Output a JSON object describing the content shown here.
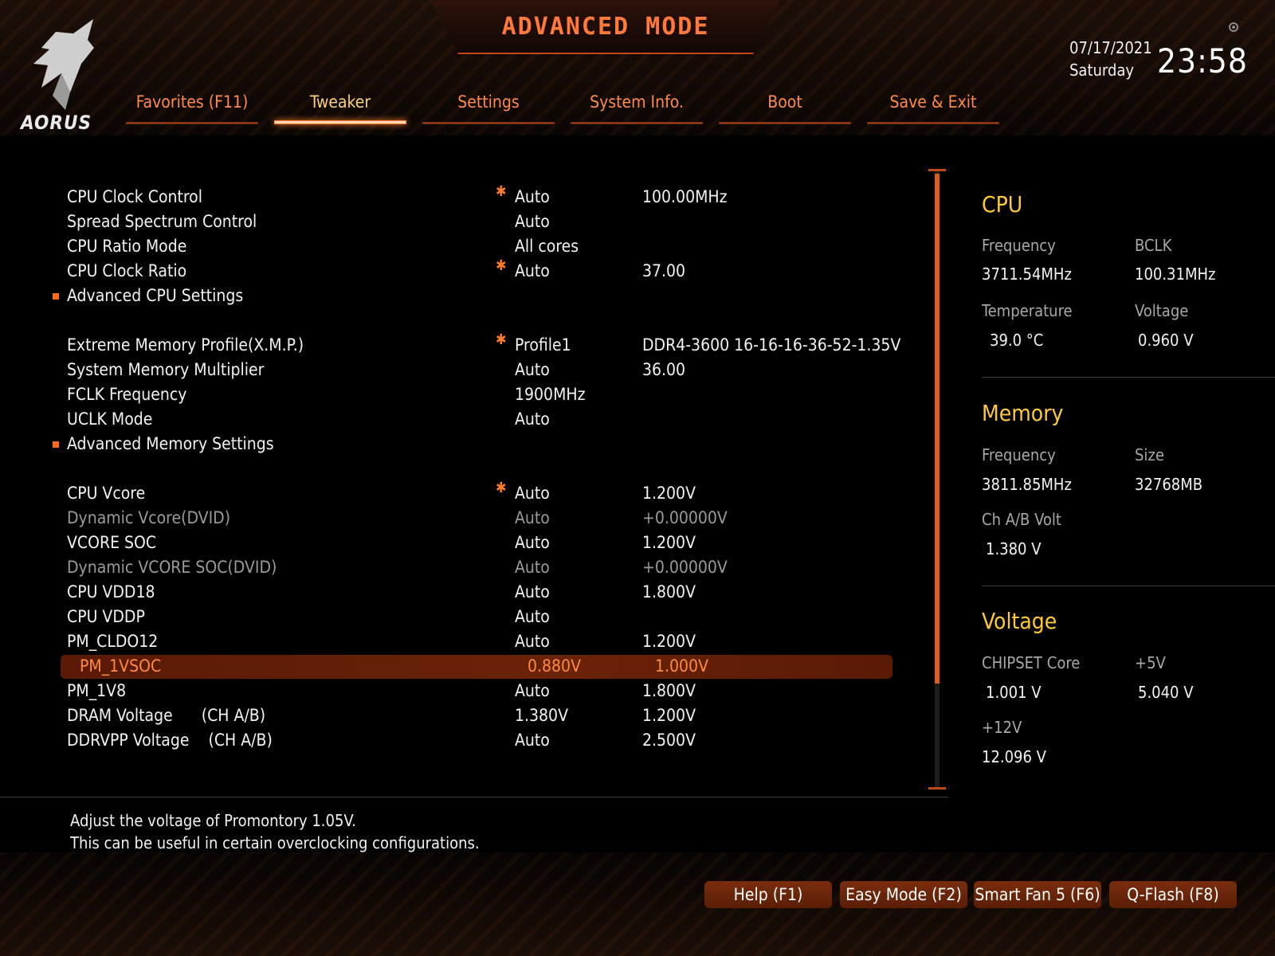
{
  "header": {
    "title": "ADVANCED MODE",
    "logo_text": "AORUS",
    "date": "07/17/2021",
    "day": "Saturday",
    "time": "23:58"
  },
  "tabs": [
    {
      "label": "Favorites (F11)"
    },
    {
      "label": "Tweaker",
      "active": true
    },
    {
      "label": "Settings"
    },
    {
      "label": "System Info."
    },
    {
      "label": "Boot"
    },
    {
      "label": "Save & Exit"
    }
  ],
  "settings": [
    {
      "name": "CPU Clock Control",
      "star": "✱",
      "v1": "Auto",
      "v2": "100.00MHz"
    },
    {
      "name": "Spread Spectrum Control",
      "star": "",
      "v1": "Auto",
      "v2": ""
    },
    {
      "name": "CPU Ratio Mode",
      "star": "",
      "v1": "All cores",
      "v2": ""
    },
    {
      "name": "CPU Clock Ratio",
      "star": "✱",
      "v1": "Auto",
      "v2": "37.00"
    },
    {
      "name": "Advanced CPU Settings",
      "star": "",
      "v1": "",
      "v2": "",
      "submenu": true
    },
    {
      "name": "Extreme Memory Profile(X.M.P.)",
      "star": "✱",
      "v1": "Profile1",
      "v2": "DDR4-3600 16-16-16-36-52-1.35V"
    },
    {
      "name": "System Memory Multiplier",
      "star": "",
      "v1": "Auto",
      "v2": "36.00"
    },
    {
      "name": "FCLK Frequency",
      "star": "",
      "v1": "1900MHz",
      "v2": ""
    },
    {
      "name": "UCLK Mode",
      "star": "",
      "v1": "Auto",
      "v2": ""
    },
    {
      "name": "Advanced Memory Settings",
      "star": "",
      "v1": "",
      "v2": "",
      "submenu": true
    },
    {
      "name": "CPU Vcore",
      "star": "✱",
      "v1": "Auto",
      "v2": "1.200V"
    },
    {
      "name": "Dynamic Vcore(DVID)",
      "star": "",
      "v1": "Auto",
      "v2": "+0.00000V",
      "dim": true
    },
    {
      "name": "VCORE SOC",
      "star": "",
      "v1": "Auto",
      "v2": "1.200V"
    },
    {
      "name": "Dynamic VCORE SOC(DVID)",
      "star": "",
      "v1": "Auto",
      "v2": "+0.00000V",
      "dim": true
    },
    {
      "name": "CPU VDD18",
      "star": "",
      "v1": "Auto",
      "v2": "1.800V"
    },
    {
      "name": "CPU VDDP",
      "star": "",
      "v1": "Auto",
      "v2": ""
    },
    {
      "name": "PM_CLDO12",
      "star": "",
      "v1": "Auto",
      "v2": "1.200V"
    },
    {
      "name": "PM_1VSOC",
      "star": "",
      "v1": "0.880V",
      "v2": "1.000V",
      "selected": true
    },
    {
      "name": "PM_1V8",
      "star": "",
      "v1": "Auto",
      "v2": "1.800V"
    },
    {
      "name": "DRAM Voltage      (CH A/B)",
      "star": "",
      "v1": "1.380V",
      "v2": "1.200V"
    },
    {
      "name": "DDRVPP Voltage    (CH A/B)",
      "star": "",
      "v1": "Auto",
      "v2": "2.500V"
    }
  ],
  "scroll": {
    "position_fraction": 0.0,
    "visible_fraction": 0.82
  },
  "info": {
    "cpu": {
      "title": "CPU",
      "frequency_label": "Frequency",
      "frequency": "3711.54MHz",
      "bclk_label": "BCLK",
      "bclk": "100.31MHz",
      "temperature_label": "Temperature",
      "temperature": "39.0 °C",
      "voltage_label": "Voltage",
      "voltage": "0.960 V"
    },
    "memory": {
      "title": "Memory",
      "frequency_label": "Frequency",
      "frequency": "3811.85MHz",
      "size_label": "Size",
      "size": "32768MB",
      "volt_label": "Ch A/B Volt",
      "volt": "1.380 V"
    },
    "voltage": {
      "title": "Voltage",
      "chipset_label": "CHIPSET Core",
      "chipset": "1.001 V",
      "p5_label": "+5V",
      "p5": "5.040 V",
      "p12_label": "+12V",
      "p12": "12.096 V"
    }
  },
  "help": {
    "line1": "Adjust the voltage of Promontory 1.05V.",
    "line2": "This can be useful in certain overclocking configurations."
  },
  "buttons": [
    {
      "label": "Help (F1)"
    },
    {
      "label": "Easy Mode (F2)"
    },
    {
      "label": "Smart Fan 5 (F6)"
    },
    {
      "label": "Q-Flash (F8)"
    }
  ],
  "colors": {
    "accent": "#ff7a2a",
    "title": "#ff7a3a",
    "section": "#ffc93a",
    "selected_bg": "#5a1a06"
  }
}
